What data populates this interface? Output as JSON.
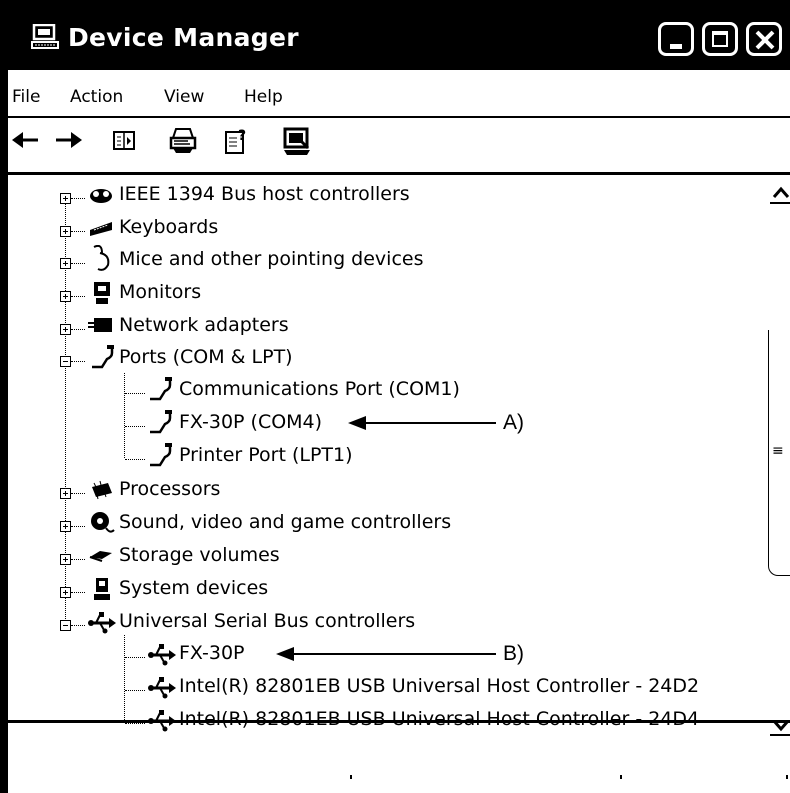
{
  "window": {
    "title": "Device Manager"
  },
  "menu": {
    "items": [
      "File",
      "Action",
      "View",
      "Help"
    ]
  },
  "toolbar": {
    "buttons": [
      {
        "icon": "back-arrow-icon",
        "label": "←"
      },
      {
        "icon": "forward-arrow-icon",
        "label": "→"
      },
      {
        "icon": "properties-icon"
      },
      {
        "icon": "print-icon"
      },
      {
        "icon": "help-icon"
      },
      {
        "icon": "scan-hardware-icon"
      }
    ]
  },
  "tree": {
    "nodes": [
      {
        "label": "IEEE 1394 Bus host controllers",
        "expanded": false
      },
      {
        "label": "Keyboards",
        "expanded": false
      },
      {
        "label": "Mice and other pointing devices",
        "expanded": false
      },
      {
        "label": "Monitors",
        "expanded": false
      },
      {
        "label": "Network adapters",
        "expanded": false
      },
      {
        "label": "Ports (COM & LPT)",
        "expanded": true,
        "children": [
          "Communications Port (COM1)",
          "FX-30P (COM4)",
          "Printer Port (LPT1)"
        ]
      },
      {
        "label": "Processors",
        "expanded": false
      },
      {
        "label": "Sound, video and game controllers",
        "expanded": false
      },
      {
        "label": "Storage volumes",
        "expanded": false
      },
      {
        "label": "System devices",
        "expanded": false
      },
      {
        "label": "Universal Serial Bus controllers",
        "expanded": true,
        "children": [
          "FX-30P",
          "Intel(R) 82801EB USB Universal Host Controller - 24D2",
          "Intel(R) 82801EB USB Universal Host Controller - 24D4"
        ]
      }
    ]
  },
  "annotations": {
    "a": "A)",
    "b": "B)"
  },
  "scrollbar": {
    "grip": "≡"
  }
}
